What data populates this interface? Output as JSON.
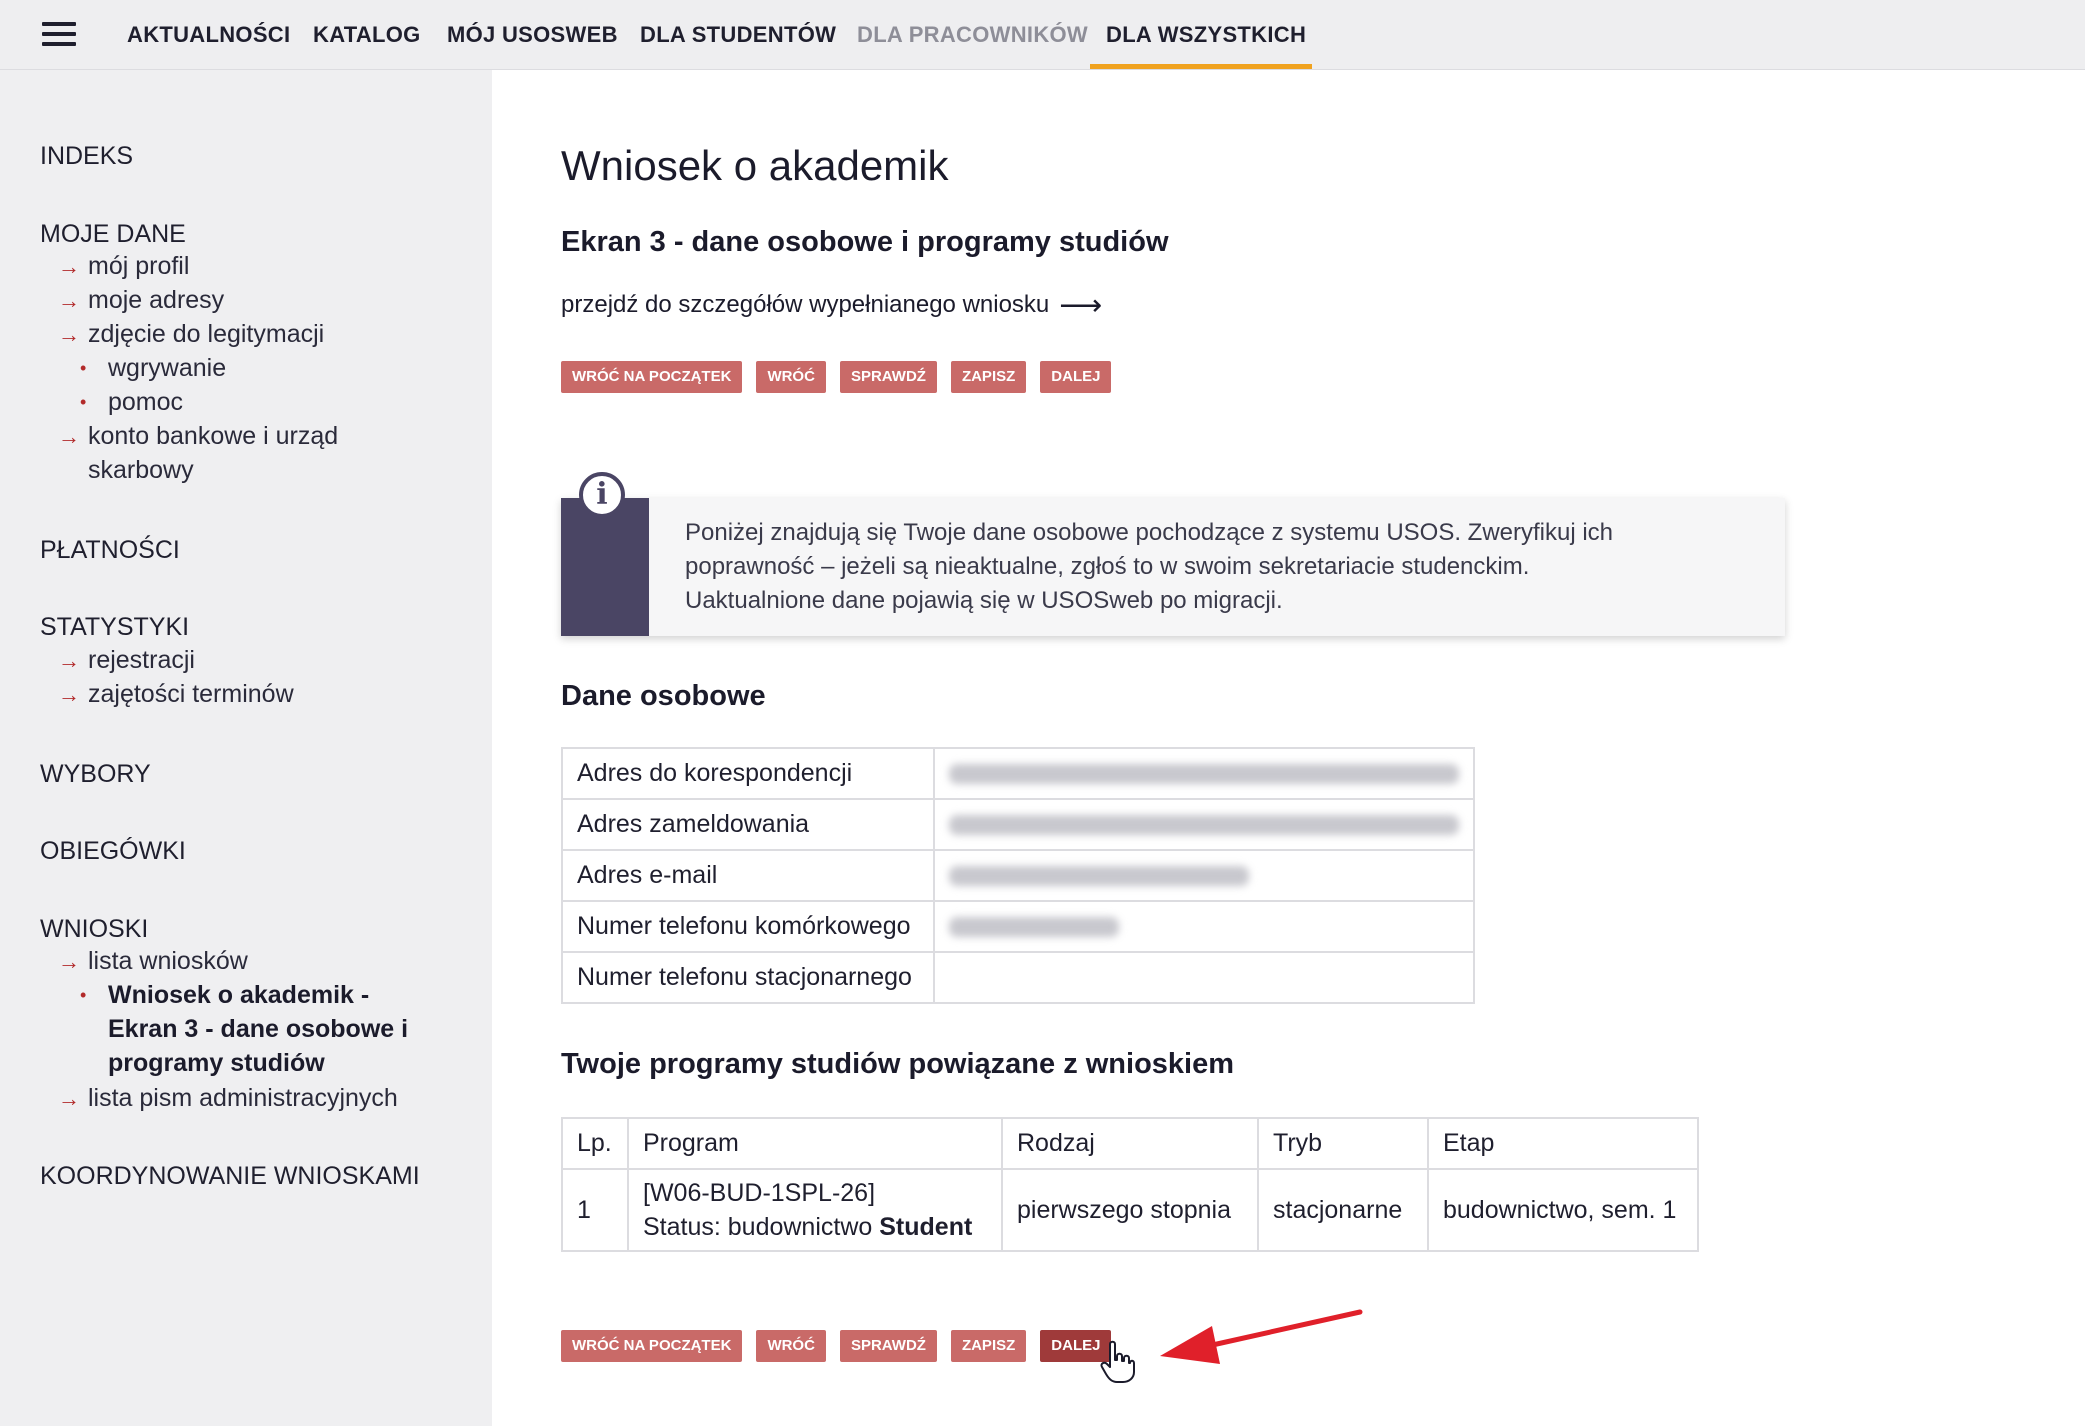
{
  "nav": {
    "items": [
      {
        "label": "AKTUALNOŚCI",
        "disabled": false
      },
      {
        "label": "KATALOG",
        "disabled": false
      },
      {
        "label": "MÓJ USOSWEB",
        "disabled": false
      },
      {
        "label": "DLA STUDENTÓW",
        "disabled": false
      },
      {
        "label": "DLA PRACOWNIKÓW",
        "disabled": true
      },
      {
        "label": "DLA WSZYSTKICH",
        "disabled": false,
        "active": true
      }
    ],
    "active_color": "#f0a21f"
  },
  "sidebar": {
    "indeks": "INDEKS",
    "moje_dane": "MOJE DANE",
    "moj_profil": "mój profil",
    "moje_adresy": "moje adresy",
    "zdjecie": "zdjęcie do legitymacji",
    "wgrywanie": "wgrywanie",
    "pomoc": "pomoc",
    "konto_1": "konto bankowe i urząd",
    "konto_2": "skarbowy",
    "platnosci": "PŁATNOŚCI",
    "statystyki": "STATYSTYKI",
    "rejestracji": "rejestracji",
    "zajetosci": "zajętości terminów",
    "wybory": "WYBORY",
    "obiegowki": "OBIEGÓWKI",
    "wnioski": "WNIOSKI",
    "lista_wnioskow": "lista wniosków",
    "active_1": "Wniosek o akademik -",
    "active_2": "Ekran 3 - dane osobowe i",
    "active_3": "programy studiów",
    "lista_pism": "lista pism administracyjnych",
    "koordynowanie": "KOORDYNOWANIE WNIOSKAMI"
  },
  "main": {
    "title": "Wniosek o akademik",
    "subtitle": "Ekran 3 - dane osobowe i programy studiów",
    "detail_link": "przejdź do szczegółów wypełnianego wniosku",
    "buttons": {
      "start": "WRÓĆ NA POCZĄTEK",
      "back": "WRÓĆ",
      "check": "SPRAWDŹ",
      "save": "ZAPISZ",
      "next": "DALEJ"
    },
    "info_lines": [
      "Poniżej znajdują się Twoje dane osobowe pochodzące z systemu USOS. Zweryfikuj ich",
      "poprawność – jeżeli są nieaktualne, zgłoś to w swoim sekretariacie studenckim.",
      "Uaktualnione dane pojawią się w USOSweb po migracji."
    ],
    "personal_heading": "Dane osobowe",
    "personal_rows": [
      {
        "label": "Adres do korespondencji",
        "redacted": true
      },
      {
        "label": "Adres zameldowania",
        "redacted": true
      },
      {
        "label": "Adres e-mail",
        "redacted": true
      },
      {
        "label": "Numer telefonu komórkowego",
        "redacted": true
      },
      {
        "label": "Numer telefonu stacjonarnego",
        "redacted": false
      }
    ],
    "programs_heading": "Twoje programy studiów powiązane z wnioskiem",
    "programs_table": {
      "headers": [
        "Lp.",
        "Program",
        "Rodzaj",
        "Tryb",
        "Etap"
      ],
      "row": {
        "lp": "1",
        "code": "[W06-BUD-1SPL-26]",
        "status_prefix": "Status: budownictwo",
        "status_bold": "Student",
        "rodzaj": "pierwszego stopnia",
        "tryb": "stacjonarne",
        "etap": "budownictwo, sem. 1"
      }
    }
  },
  "annotation_color": "#e0202a",
  "button_color": "#c96a68"
}
